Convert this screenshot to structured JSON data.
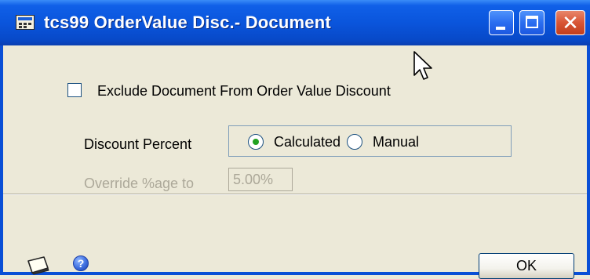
{
  "window": {
    "title": "tcs99 OrderValue Disc.- Document",
    "icons": {
      "app": "document-window-icon",
      "minimize": "minimize-icon",
      "maximize": "maximize-icon",
      "close": "close-icon"
    },
    "colors": {
      "titlebar": "#0a55dc",
      "close_button": "#d85535",
      "client_bg": "#ece9d8"
    }
  },
  "form": {
    "exclude_checkbox": {
      "label": "Exclude Document  From Order Value Discount",
      "checked": false
    },
    "discount_percent": {
      "label": "Discount Percent",
      "options": [
        {
          "label": "Calculated",
          "selected": true
        },
        {
          "label": "Manual",
          "selected": false
        }
      ]
    },
    "override": {
      "label": "Override %age to",
      "value": "5.00%",
      "enabled": false
    }
  },
  "footer": {
    "note_icon": "note-icon",
    "help_icon": "help-icon",
    "ok_label": "OK"
  }
}
